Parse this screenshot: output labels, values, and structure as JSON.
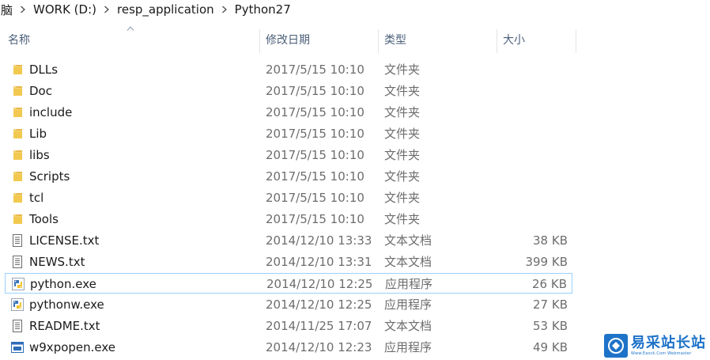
{
  "breadcrumb": {
    "items": [
      {
        "label": "脑"
      },
      {
        "label": "WORK (D:)"
      },
      {
        "label": "resp_application"
      },
      {
        "label": "Python27"
      }
    ]
  },
  "columns": {
    "name": "名称",
    "date": "修改日期",
    "type": "类型",
    "size": "大小"
  },
  "files": [
    {
      "name": "DLLs",
      "date": "2017/5/15 10:10",
      "type": "文件夹",
      "size": "",
      "icon": "folder-icon"
    },
    {
      "name": "Doc",
      "date": "2017/5/15 10:10",
      "type": "文件夹",
      "size": "",
      "icon": "folder-icon"
    },
    {
      "name": "include",
      "date": "2017/5/15 10:10",
      "type": "文件夹",
      "size": "",
      "icon": "folder-icon"
    },
    {
      "name": "Lib",
      "date": "2017/5/15 10:10",
      "type": "文件夹",
      "size": "",
      "icon": "folder-icon"
    },
    {
      "name": "libs",
      "date": "2017/5/15 10:10",
      "type": "文件夹",
      "size": "",
      "icon": "folder-icon"
    },
    {
      "name": "Scripts",
      "date": "2017/5/15 10:10",
      "type": "文件夹",
      "size": "",
      "icon": "folder-icon"
    },
    {
      "name": "tcl",
      "date": "2017/5/15 10:10",
      "type": "文件夹",
      "size": "",
      "icon": "folder-icon"
    },
    {
      "name": "Tools",
      "date": "2017/5/15 10:10",
      "type": "文件夹",
      "size": "",
      "icon": "folder-icon"
    },
    {
      "name": "LICENSE.txt",
      "date": "2014/12/10 13:33",
      "type": "文本文档",
      "size": "38 KB",
      "icon": "text-file-icon"
    },
    {
      "name": "NEWS.txt",
      "date": "2014/12/10 13:31",
      "type": "文本文档",
      "size": "399 KB",
      "icon": "text-file-icon"
    },
    {
      "name": "python.exe",
      "date": "2014/12/10 12:25",
      "type": "应用程序",
      "size": "26 KB",
      "icon": "python-icon",
      "selected": true
    },
    {
      "name": "pythonw.exe",
      "date": "2014/12/10 12:25",
      "type": "应用程序",
      "size": "27 KB",
      "icon": "python-icon"
    },
    {
      "name": "README.txt",
      "date": "2014/11/25 17:07",
      "type": "文本文档",
      "size": "53 KB",
      "icon": "text-file-icon"
    },
    {
      "name": "w9xpopen.exe",
      "date": "2014/12/10 12:23",
      "type": "应用程序",
      "size": "49 KB",
      "icon": "exe-icon"
    }
  ],
  "colors": {
    "folder": "#e8b948",
    "selection_border": "#99d1ff",
    "header_text": "#4c607a",
    "muted_text": "#6d6d6d",
    "watermark": "#1e73c9"
  },
  "watermark": {
    "title": "易采站长站",
    "subtitle": "Www.Easck.Com Webmaster"
  }
}
